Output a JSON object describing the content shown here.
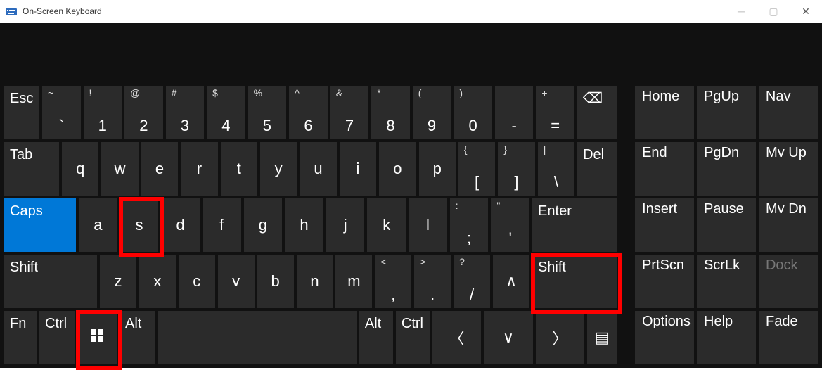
{
  "window": {
    "title": "On-Screen Keyboard"
  },
  "rows": {
    "r1": {
      "esc": "Esc",
      "k1t": "~",
      "k1b": "`",
      "k2t": "!",
      "k2b": "1",
      "k3t": "@",
      "k3b": "2",
      "k4t": "#",
      "k4b": "3",
      "k5t": "$",
      "k5b": "4",
      "k6t": "%",
      "k6b": "5",
      "k7t": "^",
      "k7b": "6",
      "k8t": "&",
      "k8b": "7",
      "k9t": "*",
      "k9b": "8",
      "k10t": "(",
      "k10b": "9",
      "k11t": ")",
      "k11b": "0",
      "k12t": "_",
      "k12b": "-",
      "k13t": "+",
      "k13b": "=",
      "side1": "Home",
      "side2": "PgUp",
      "side3": "Nav"
    },
    "r2": {
      "tab": "Tab",
      "q": "q",
      "w": "w",
      "e": "e",
      "r": "r",
      "t": "t",
      "y": "y",
      "u": "u",
      "i": "i",
      "o": "o",
      "p": "p",
      "br1t": "{",
      "br1b": "[",
      "br2t": "}",
      "br2b": "]",
      "bslt": "|",
      "bslb": "\\",
      "del": "Del",
      "side1": "End",
      "side2": "PgDn",
      "side3": "Mv Up"
    },
    "r3": {
      "caps": "Caps",
      "a": "a",
      "s": "s",
      "d": "d",
      "f": "f",
      "g": "g",
      "h": "h",
      "j": "j",
      "k": "k",
      "l": "l",
      "sc1t": ":",
      "sc1b": ";",
      "sc2t": "\"",
      "sc2b": "'",
      "enter": "Enter",
      "side1": "Insert",
      "side2": "Pause",
      "side3": "Mv Dn"
    },
    "r4": {
      "lshift": "Shift",
      "z": "z",
      "x": "x",
      "c": "c",
      "v": "v",
      "b": "b",
      "n": "n",
      "m": "m",
      "c1t": "<",
      "c1b": ",",
      "c2t": ">",
      "c2b": ".",
      "c3t": "?",
      "c3b": "/",
      "rshift": "Shift",
      "side1": "PrtScn",
      "side2": "ScrLk",
      "side3": "Dock"
    },
    "r5": {
      "fn": "Fn",
      "ctrl": "Ctrl",
      "alt": "Alt",
      "ralt": "Alt",
      "rctrl": "Ctrl",
      "side1": "Options",
      "side2": "Help",
      "side3": "Fade"
    }
  },
  "highlights": [
    "key-s",
    "key-right-shift",
    "key-windows"
  ],
  "colors": {
    "highlight": "#ff0000",
    "active": "#0078d7"
  }
}
